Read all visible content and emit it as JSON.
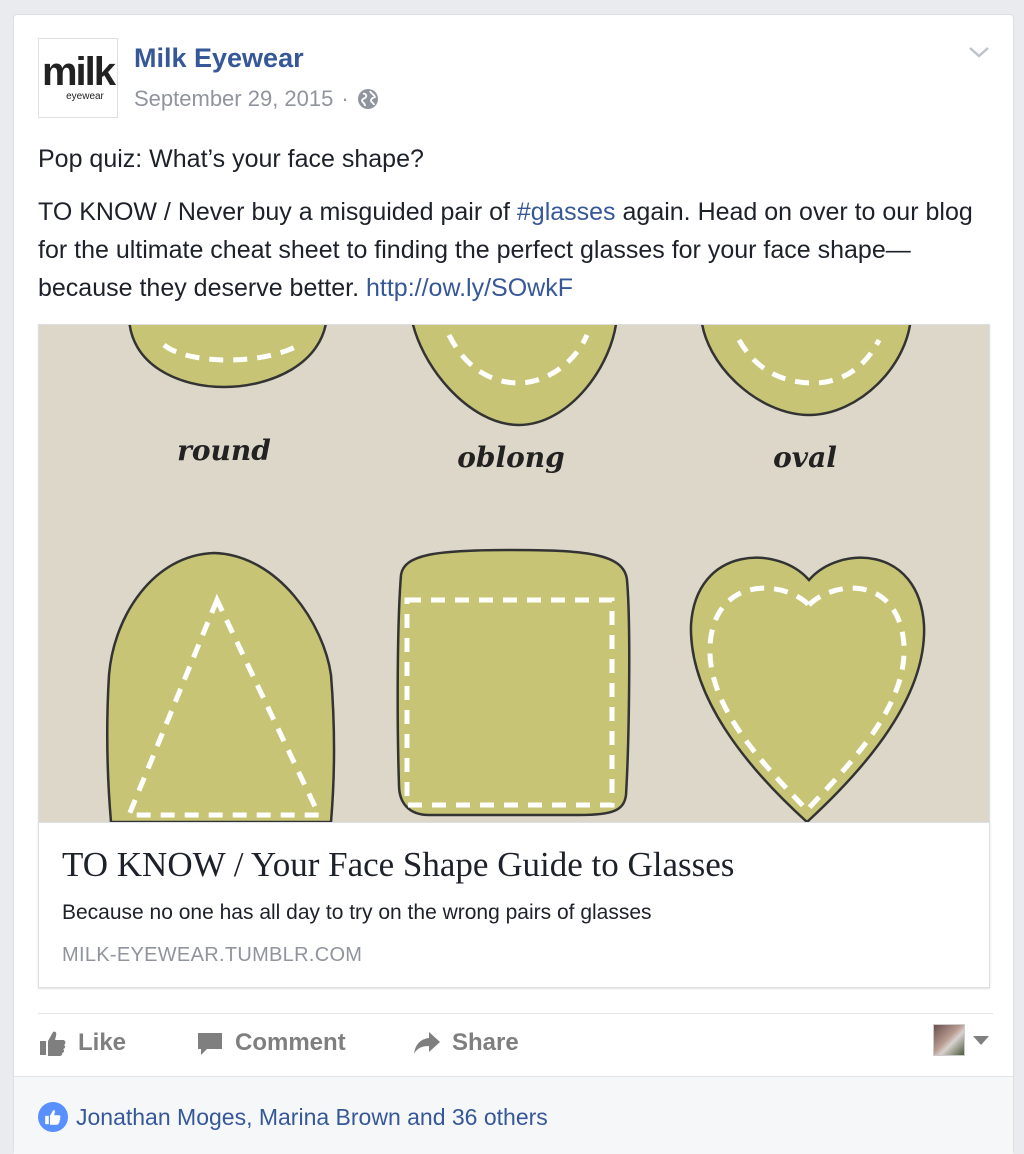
{
  "post": {
    "logo_text": "milk",
    "logo_subtext": "eyewear",
    "page_name": "Milk Eyewear",
    "date": "September 29, 2015",
    "separator": "·",
    "privacy_icon": "globe-icon",
    "menu_icon": "chevron-down-icon",
    "quiz_line": "Pop quiz: What’s your face shape?",
    "body": {
      "part1": "TO KNOW / Never buy a misguided pair of ",
      "hashtag": "#glasses",
      "part2": " again. Head on over to our blog for the ultimate cheat sheet to finding the perfect glasses for your face shape—because they deserve better. ",
      "link": "http://ow.ly/SOwkF"
    }
  },
  "link_preview": {
    "image_labels": [
      "round",
      "oblong",
      "oval"
    ],
    "title": "TO KNOW / Your Face Shape Guide to Glasses",
    "description": "Because no one has all day to try on the wrong pairs of glasses",
    "domain": "MILK-EYEWEAR.TUMBLR.COM",
    "colors": {
      "background": "#ddd7c9",
      "shape_fill": "#c7c575",
      "stroke": "#333333"
    }
  },
  "actions": {
    "like_label": "Like",
    "comment_label": "Comment",
    "share_label": "Share",
    "like_icon": "thumbs-up-icon",
    "comment_icon": "speech-bubble-icon",
    "share_icon": "share-arrow-icon"
  },
  "footer": {
    "likes_text": "Jonathan Moges, Marina Brown and 36 others"
  },
  "colors": {
    "link": "#365899",
    "muted": "#90949c",
    "accent": "#5890ff"
  }
}
